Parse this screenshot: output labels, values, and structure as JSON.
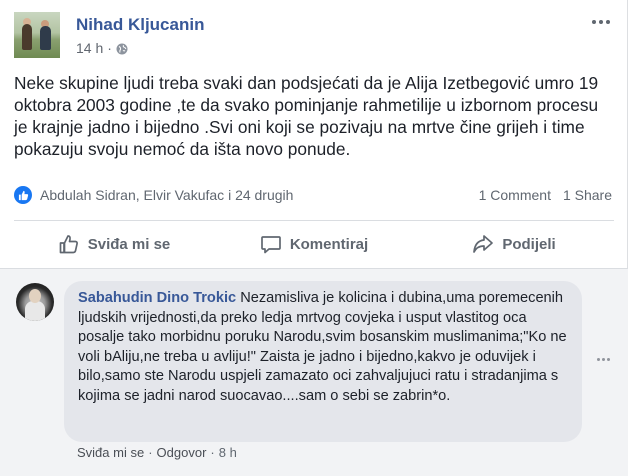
{
  "post": {
    "author": "Nihad Kljucanin",
    "time": "14 h",
    "separator": "·",
    "text": "Neke skupine ljudi treba svaki dan podsjećati da je Alija Izetbegović umro 19 oktobra 2003 godine ,te da svako pominjanje rahmetilije u izbornom procesu je krajnje jadno i bijedno .Svi oni koji se pozivaju na mrtve čine grijeh i time pokazuju svoju nemoć da išta novo ponude.",
    "reactors": "Abdulah Sidran, Elvir Vakufac i 24 drugih",
    "comments_count": "1 Comment",
    "shares_count": "1 Share"
  },
  "actions": {
    "like": "Sviđa mi se",
    "comment": "Komentiraj",
    "share": "Podijeli"
  },
  "comment": {
    "author": "Sabahudin Dino Trokic",
    "text": "Nezamisliva je kolicina i dubina,uma poremecenih ljudskih vrijednosti,da preko ledja mrtvog covjeka i usput vlastitog oca posalje tako morbidnu poruku Narodu,svim bosanskim muslimanima;\"Ko ne voli bAliju,ne treba u avliju!\" Zaista je jadno i bijedno,kakvo je oduvijek i bilo,samo ste Narodu uspjeli zamazato oci zahvaljujuci ratu i stradanjima s kojima se jadni narod suocavao....sam o sebi se zabrin*o.",
    "like_label": "Sviđa mi se",
    "reply_label": "Odgovor",
    "separator": "·",
    "time": "8 h"
  },
  "colors": {
    "name_link": "#385898",
    "like_blue": "#1877f2",
    "muted": "#606770"
  },
  "icons": {
    "privacy": "globe-icon",
    "more": "more-dots-icon",
    "reaction": "like-thumb-icon"
  }
}
